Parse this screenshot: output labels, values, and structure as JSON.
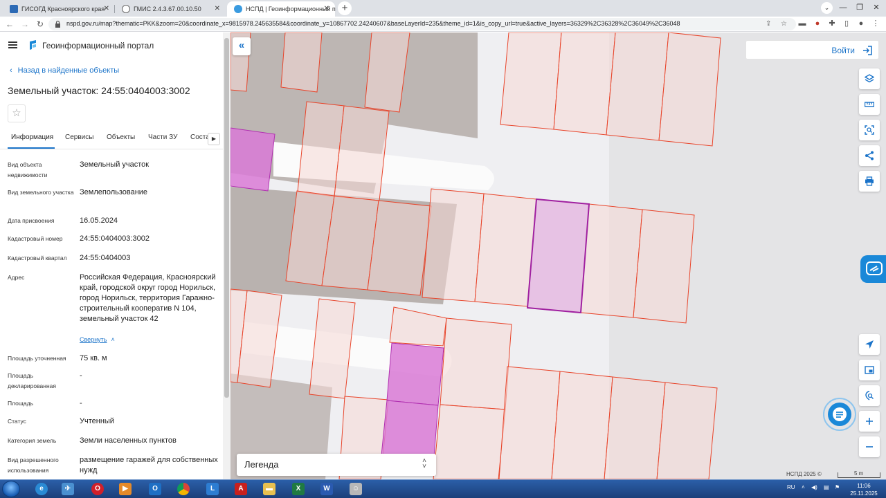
{
  "browser": {
    "tabs": [
      {
        "title": "ГИСОГД Красноярского края",
        "active": false
      },
      {
        "title": "ГМИС 2.4.3.67.00.10.50",
        "active": false
      },
      {
        "title": "НСПД | Геоинформационный п",
        "active": true
      }
    ],
    "url": "nspd.gov.ru/map?thematic=PKK&zoom=20&coordinate_x=9815978.245635584&coordinate_y=10867702.24240607&baseLayerId=235&theme_id=1&is_copy_url=true&active_layers=36329%2C36328%2C36049%2C36048"
  },
  "header": {
    "portal_title": "Геоинформационный портал"
  },
  "panel": {
    "back_link": "Назад в найденные объекты",
    "object_title": "Земельный участок: 24:55:0404003:3002",
    "star": "☆",
    "tabs": [
      "Информация",
      "Сервисы",
      "Объекты",
      "Части ЗУ",
      "Соста"
    ],
    "properties": [
      {
        "key": "Вид объекта недвижимости",
        "value": "Земельный участок"
      },
      {
        "key": "Вид земельного участка",
        "value": "Землепользование"
      },
      {
        "key": "Дата присвоения",
        "value": "16.05.2024"
      },
      {
        "key": "Кадастровый номер",
        "value": "24:55:0404003:3002"
      },
      {
        "key": "Кадастровый квартал",
        "value": "24:55:0404003"
      },
      {
        "key": "Адрес",
        "value": "Российская Федерация, Красноярский край, городской округ город Норильск, город Норильск, территория Гаражно-строительный кооператив N 104, земельный участок 42"
      },
      {
        "key": "Площадь уточненная",
        "value": "75 кв. м"
      },
      {
        "key": "Площадь декларированная",
        "value": "-"
      },
      {
        "key": "Площадь",
        "value": "-"
      },
      {
        "key": "Статус",
        "value": "Учтенный"
      },
      {
        "key": "Категория земель",
        "value": "Земли населенных пунктов"
      },
      {
        "key": "Вид разрешенного использования",
        "value": "размещение гаражей для собственных нужд"
      }
    ],
    "collapse_link": "Свернуть"
  },
  "map": {
    "login_label": "Войти",
    "legend_label": "Легенда",
    "copyright": "НСПД 2025 ©",
    "scale_label": "5 m",
    "colors": {
      "parcel_stroke": "#e8442a",
      "parcel_fill": "#f6d9d5",
      "selected_stroke": "#a020a0",
      "selected_fill": "#e6bde2",
      "highlight_fill": "#d97ad6",
      "accent": "#1a73c9"
    },
    "tools": [
      "layers-icon",
      "ruler-icon",
      "zoom-area-icon",
      "share-icon",
      "print-icon",
      "locate-icon",
      "minimap-icon",
      "geo-search-icon",
      "zoom-in-icon",
      "zoom-out-icon"
    ]
  },
  "taskbar": {
    "lang": "RU",
    "time": "11:06",
    "date": "25.11.2025"
  }
}
